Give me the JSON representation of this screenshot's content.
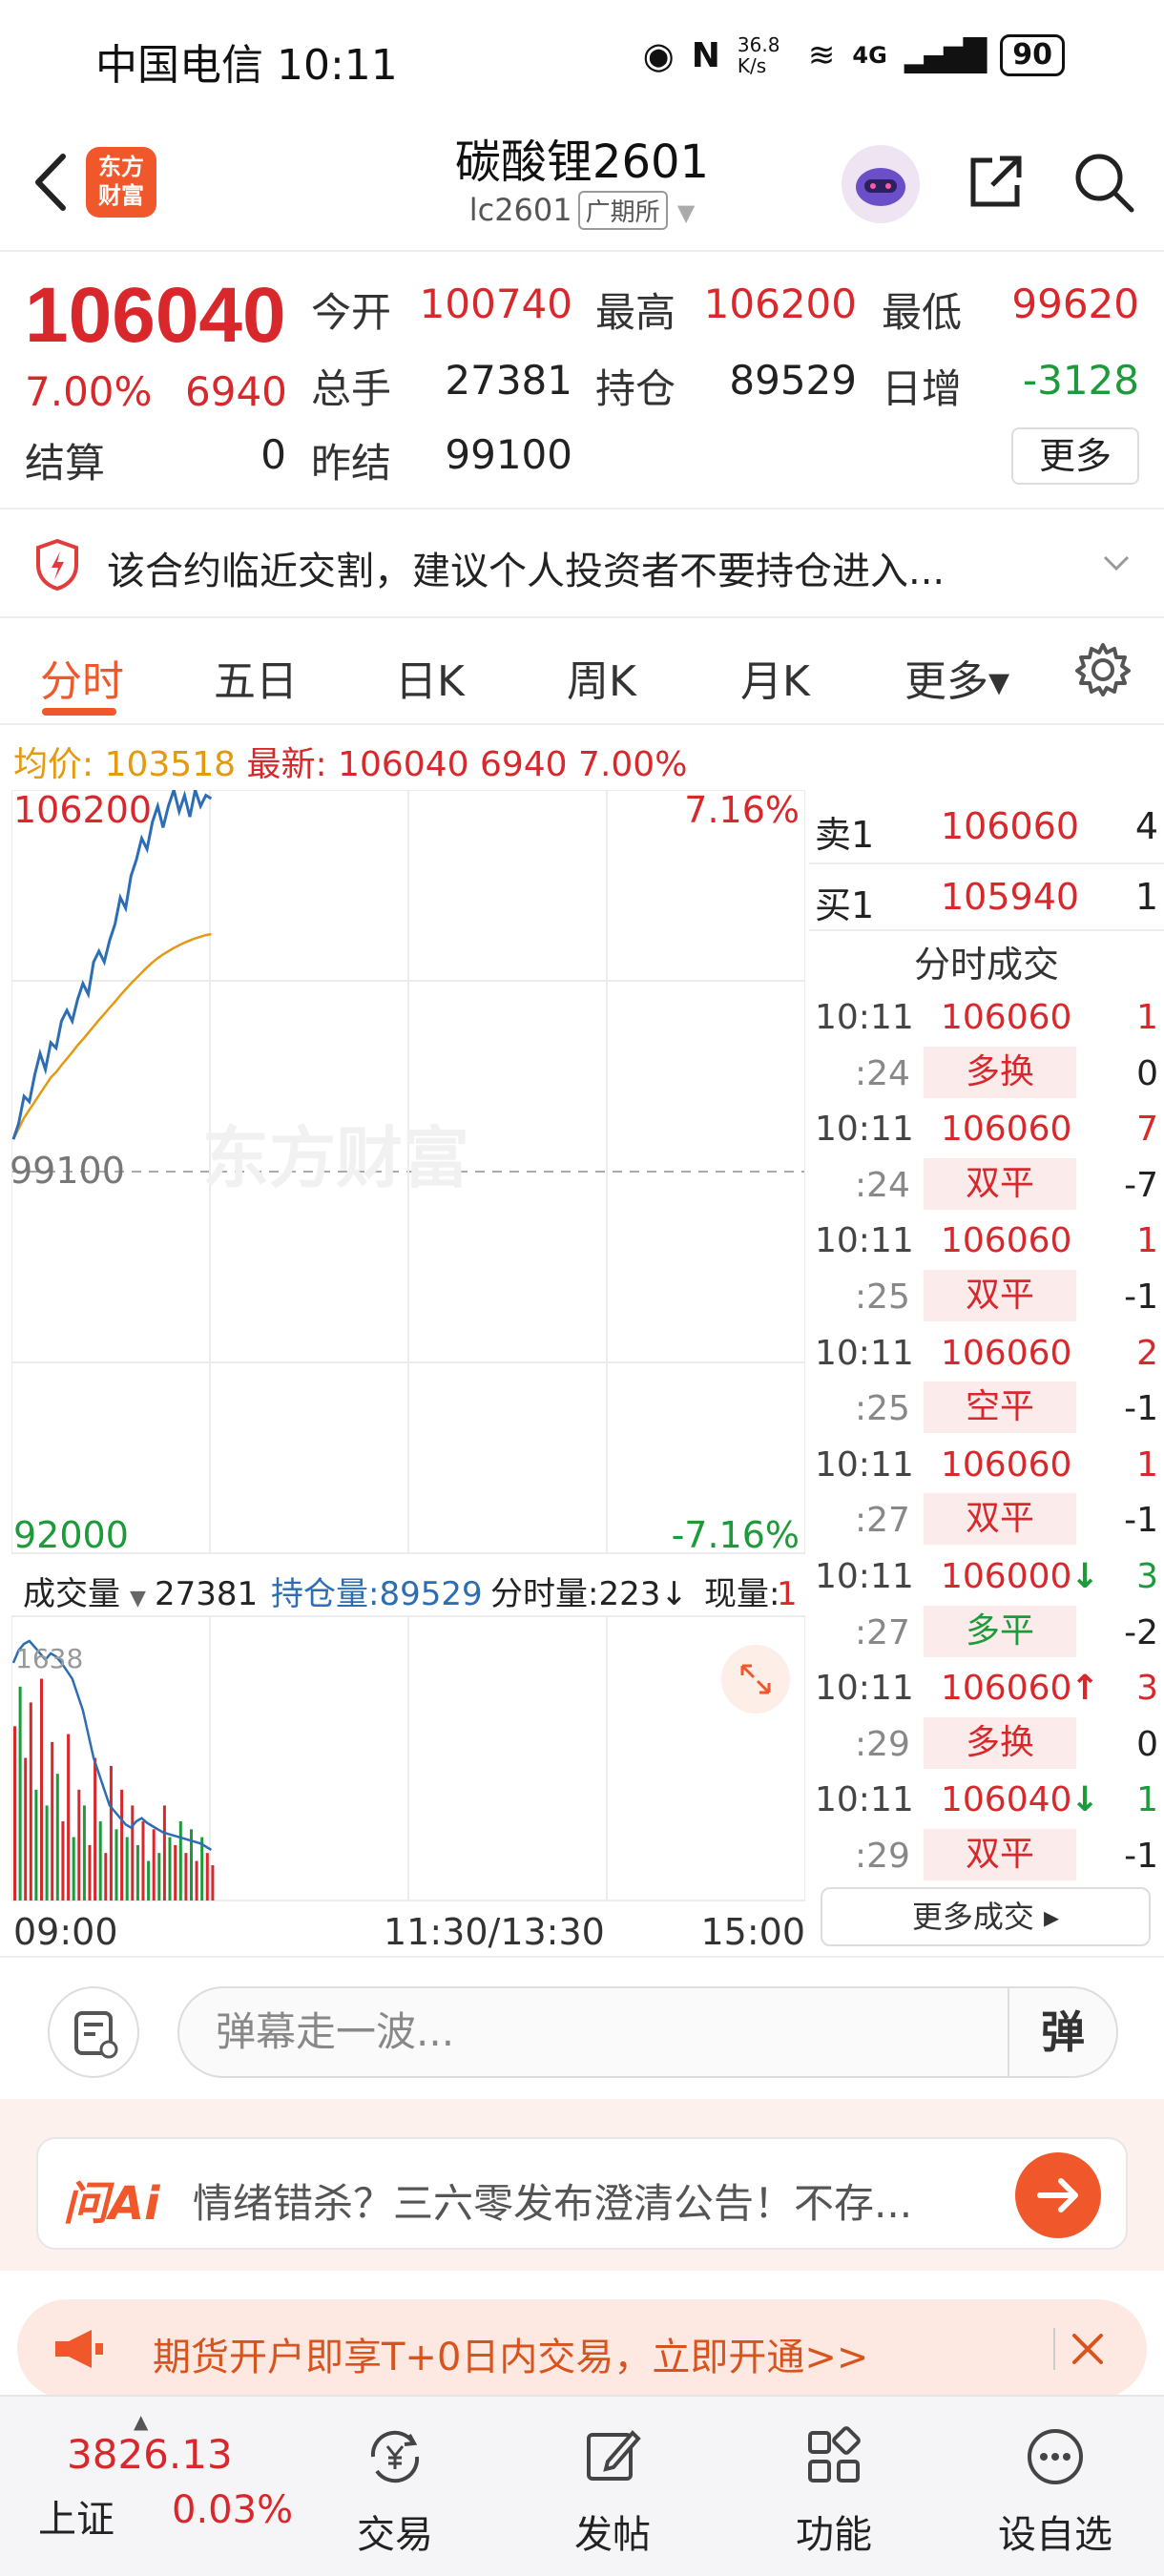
{
  "status_bar": {
    "carrier_time": "中国电信 10:11",
    "net_speed": "36.8 K/s",
    "signal": "4G",
    "battery": "90"
  },
  "header": {
    "brand_logo_text": "东方财富",
    "title": "碳酸锂2601",
    "code": "lc2601",
    "exchange": "广期所"
  },
  "quote": {
    "price": "106040",
    "change_pct": "7.00%",
    "change_abs": "6940",
    "settle_label": "结算",
    "settle_value": "0",
    "fields": [
      {
        "label": "今开",
        "value": "100740",
        "color": "red"
      },
      {
        "label": "最高",
        "value": "106200",
        "color": "red"
      },
      {
        "label": "最低",
        "value": "99620",
        "color": "red"
      },
      {
        "label": "总手",
        "value": "27381",
        "color": "black"
      },
      {
        "label": "持仓",
        "value": "89529",
        "color": "black"
      },
      {
        "label": "日增",
        "value": "-3128",
        "color": "green"
      },
      {
        "label": "昨结",
        "value": "99100",
        "color": "black"
      }
    ],
    "more_label": "更多"
  },
  "warning": {
    "text": "该合约临近交割，建议个人投资者不要持仓进入..."
  },
  "tabs": [
    {
      "label": "分时",
      "active": true
    },
    {
      "label": "五日",
      "active": false
    },
    {
      "label": "日K",
      "active": false
    },
    {
      "label": "周K",
      "active": false
    },
    {
      "label": "月K",
      "active": false
    },
    {
      "label": "更多▾",
      "active": false
    }
  ],
  "avg_line": {
    "avg_label": "均价:",
    "avg_value": "103518",
    "latest_label": "最新:",
    "latest_value": "106040",
    "latest_chg": "6940",
    "latest_pct": "7.00%"
  },
  "chart_data": {
    "type": "line",
    "price_axis": {
      "top": "106200",
      "mid": "99100",
      "bottom": "92000",
      "top_pct": "7.16%",
      "bottom_pct": "-7.16%",
      "ylim": [
        92000,
        106200
      ]
    },
    "time_axis": [
      "09:00",
      "11:30/13:30",
      "15:00"
    ],
    "watermark": "东方财富",
    "series": [
      {
        "name": "价格",
        "color": "#2c6db3",
        "values": [
          99700,
          100000,
          100500,
          100400,
          100900,
          101300,
          101000,
          101500,
          101400,
          101900,
          102100,
          101900,
          102300,
          102600,
          102400,
          103000,
          103200,
          103000,
          103400,
          103700,
          104200,
          104000,
          104600,
          104900,
          105300,
          105100,
          105600,
          105900,
          105500,
          105900,
          106200,
          105800,
          106100,
          105700,
          106200,
          105900,
          106100,
          106040
        ]
      },
      {
        "name": "均价",
        "color": "#e39a10",
        "values": [
          99700,
          99900,
          100100,
          100250,
          100400,
          100550,
          100700,
          100850,
          100950,
          101080,
          101200,
          101320,
          101450,
          101560,
          101680,
          101800,
          101920,
          102030,
          102150,
          102260,
          102380,
          102490,
          102600,
          102700,
          102800,
          102900,
          102990,
          103070,
          103140,
          103200,
          103260,
          103310,
          103360,
          103400,
          103440,
          103470,
          103500,
          103518
        ]
      }
    ],
    "volume_panel": {
      "volume_label": "成交量",
      "volume_value": "27381",
      "oi_label": "持仓量:89529",
      "tick_vol_label": "分时量:223↓",
      "now_vol_label": "现量:",
      "now_vol_value": "1",
      "max_label": "1638",
      "volumes": [
        1100,
        1350,
        900,
        1250,
        700,
        1400,
        600,
        1000,
        800,
        500,
        1050,
        400,
        700,
        600,
        350,
        900,
        500,
        300,
        850,
        450,
        700,
        400,
        600,
        350,
        500,
        250,
        450,
        300,
        600,
        400,
        350,
        500,
        300,
        450,
        250,
        400,
        300,
        223
      ],
      "vol_colors": [
        "red",
        "green",
        "red",
        "red",
        "green",
        "red",
        "green",
        "red",
        "green",
        "red",
        "red",
        "green",
        "red",
        "green",
        "red",
        "red",
        "green",
        "red",
        "red",
        "green",
        "red",
        "green",
        "red",
        "green",
        "red",
        "green",
        "red",
        "green",
        "red",
        "green",
        "red",
        "green",
        "red",
        "green",
        "red",
        "green",
        "red",
        "red"
      ],
      "oi_line": [
        1500,
        1580,
        1620,
        1638,
        1600,
        1560,
        1520,
        1560,
        1540,
        1500,
        1450,
        1400,
        1300,
        1200,
        1050,
        900,
        800,
        700,
        600,
        560,
        520,
        480,
        460,
        500,
        520,
        490,
        470,
        450,
        430,
        420,
        410,
        400,
        390,
        380,
        370,
        360,
        340,
        320
      ]
    }
  },
  "order_book": {
    "sell": {
      "label": "卖1",
      "price": "106060",
      "qty": "4"
    },
    "buy": {
      "label": "买1",
      "price": "105940",
      "qty": "1"
    },
    "trades_title": "分时成交",
    "trades": [
      {
        "time": "10:11",
        "price": "106060",
        "arrow": "",
        "qty": "1",
        "qty_color": "red"
      },
      {
        "time": ":24",
        "tag": "多换",
        "tag_color": "red",
        "qty": "0",
        "qty_color": "black"
      },
      {
        "time": "10:11",
        "price": "106060",
        "arrow": "",
        "qty": "7",
        "qty_color": "red"
      },
      {
        "time": ":24",
        "tag": "双平",
        "tag_color": "red",
        "qty": "-7",
        "qty_color": "black"
      },
      {
        "time": "10:11",
        "price": "106060",
        "arrow": "",
        "qty": "1",
        "qty_color": "red"
      },
      {
        "time": ":25",
        "tag": "双平",
        "tag_color": "red",
        "qty": "-1",
        "qty_color": "black"
      },
      {
        "time": "10:11",
        "price": "106060",
        "arrow": "",
        "qty": "2",
        "qty_color": "red"
      },
      {
        "time": ":25",
        "tag": "空平",
        "tag_color": "red",
        "qty": "-1",
        "qty_color": "black"
      },
      {
        "time": "10:11",
        "price": "106060",
        "arrow": "",
        "qty": "1",
        "qty_color": "red"
      },
      {
        "time": ":27",
        "tag": "双平",
        "tag_color": "red",
        "qty": "-1",
        "qty_color": "black"
      },
      {
        "time": "10:11",
        "price": "106000",
        "arrow": "↓",
        "arrow_color": "green",
        "qty": "3",
        "qty_color": "green"
      },
      {
        "time": ":27",
        "tag": "多平",
        "tag_color": "green",
        "qty": "-2",
        "qty_color": "black"
      },
      {
        "time": "10:11",
        "price": "106060",
        "arrow": "↑",
        "arrow_color": "red",
        "qty": "3",
        "qty_color": "red"
      },
      {
        "time": ":29",
        "tag": "多换",
        "tag_color": "red",
        "qty": "0",
        "qty_color": "black"
      },
      {
        "time": "10:11",
        "price": "106040",
        "arrow": "↓",
        "arrow_color": "green",
        "qty": "1",
        "qty_color": "green"
      },
      {
        "time": ":29",
        "tag": "双平",
        "tag_color": "red",
        "qty": "-1",
        "qty_color": "black"
      }
    ],
    "more_trades_label": "更多成交 ▸"
  },
  "danmaku": {
    "placeholder": "弹幕走一波...",
    "button": "弹"
  },
  "ai_bar": {
    "logo": "问Ai",
    "text": "情绪错杀？三六零发布澄清公告！不存..."
  },
  "promo": {
    "text": "期货开户即享T+0日内交易，立即开通>>"
  },
  "bottom_nav": {
    "index_value": "3826.13",
    "index_name": "上证",
    "index_pct": "0.03%",
    "items": [
      {
        "label": "交易",
        "icon": "yen-exchange-icon"
      },
      {
        "label": "发帖",
        "icon": "edit-post-icon"
      },
      {
        "label": "功能",
        "icon": "grid-apps-icon"
      },
      {
        "label": "设自选",
        "icon": "more-dots-icon"
      }
    ]
  },
  "colors": {
    "up": "#d8282c",
    "down": "#1d9a3a",
    "accent": "#f0572a",
    "price_line": "#2c6db3",
    "avg_line": "#e39a10"
  }
}
